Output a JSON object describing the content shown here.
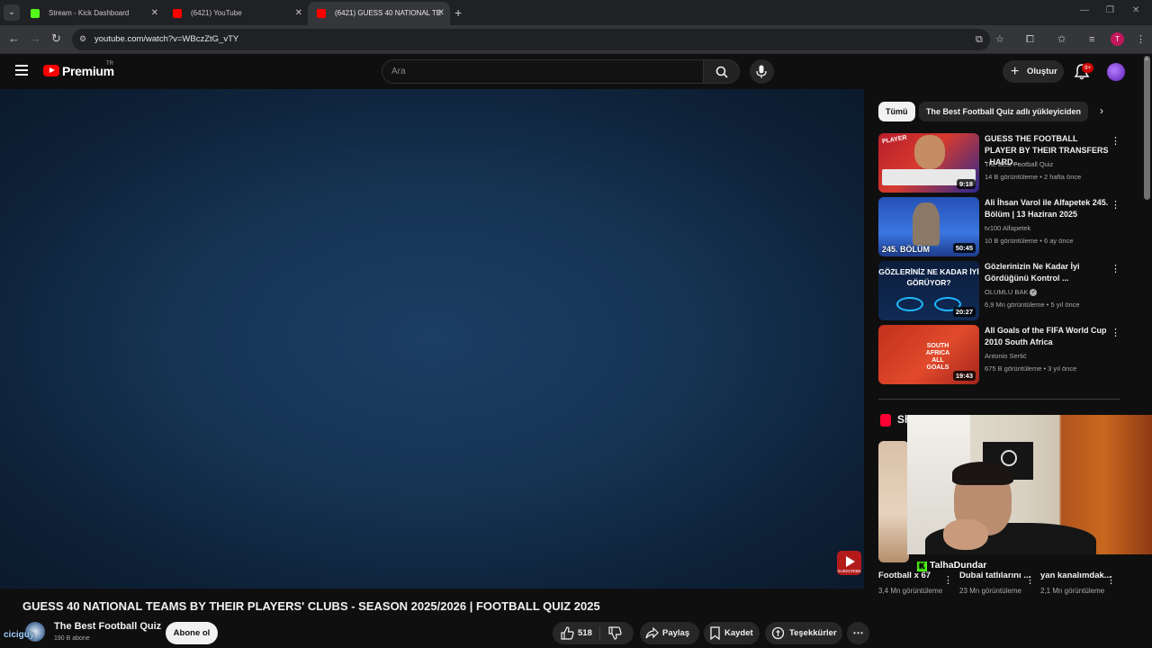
{
  "browser": {
    "tabs": [
      {
        "label": "Stream - Kick Dashboard",
        "favicon_color": "#53fc18"
      },
      {
        "label": "(6421) YouTube",
        "favicon_color": "#ff0000"
      },
      {
        "label": "(6421) GUESS 40 NATIONAL TE",
        "favicon_color": "#ff0000",
        "active": true
      }
    ],
    "url": "youtube.com/watch?v=WBczZtG_vTY",
    "profile_letter": "T"
  },
  "masthead": {
    "brand": "Premium",
    "country": "TR",
    "search_placeholder": "Ara",
    "create_label": "Oluştur",
    "notifications_badge": "9+"
  },
  "video": {
    "title": "GUESS 40 NATIONAL TEAMS BY THEIR PLAYERS' CLUBS - SEASON 2025/2026 | FOOTBALL QUIZ 2025",
    "channel_name": "The Best Football Quiz",
    "channel_subs": "190 B abone",
    "subscribe_label": "Abone ol",
    "likes": "518",
    "share_label": "Paylaş",
    "save_label": "Kaydet",
    "thanks_label": "Teşekkürler",
    "watermark_label": "SUBSCRIBE",
    "overlay_handle": "ciciguy"
  },
  "sidebar": {
    "chips": [
      "Tümü",
      "The Best Football Quiz adlı yükleyiciden"
    ],
    "recommendations": [
      {
        "title": "GUESS THE FOOTBALL PLAYER BY THEIR TRANSFERS - HARD...",
        "channel": "The Best Football Quiz",
        "meta": "14 B görüntüleme • 2 hafta önce",
        "duration": "9:18",
        "thumb_text": "PLAYER"
      },
      {
        "title": "Ali İhsan Varol ile Alfapetek 245. Bölüm | 13 Haziran 2025",
        "channel": "tv100 Alfapetek",
        "meta": "10 B görüntüleme • 6 ay önce",
        "duration": "50:45",
        "thumb_text": "245. BÖLÜM"
      },
      {
        "title": "Gözlerinizin Ne Kadar İyi Gördüğünü Kontrol ...",
        "channel": "OLUMLU BAK",
        "meta": "6,9 Mn görüntüleme • 5 yıl önce",
        "duration": "20:27",
        "thumb_text": "GÖZLERİNİZ NE KADAR İYİ GÖRÜYOR?",
        "verified": true
      },
      {
        "title": "All Goals of the FIFA World Cup 2010 South Africa",
        "channel": "Antonio Sertić",
        "meta": "675 B görüntüleme • 3 yıl önce",
        "duration": "19:43",
        "thumb_text": "SOUTH AFRICA ALL GOALS"
      }
    ],
    "shorts_title": "Sh",
    "shorts": [
      {
        "title": "Football x 67",
        "views": "3,4 Mn görüntüleme"
      },
      {
        "title": "Dubai tatlılarını ...",
        "views": "23 Mn görüntüleme"
      },
      {
        "title": "yan kanalımdak...",
        "views": "2,1 Mn görüntüleme"
      }
    ]
  },
  "webcam": {
    "streamer_name": "TalhaDundar"
  },
  "colors": {
    "youtube_red": "#ff0000",
    "kick_green": "#53fc18",
    "background": "#0f0f0f"
  }
}
